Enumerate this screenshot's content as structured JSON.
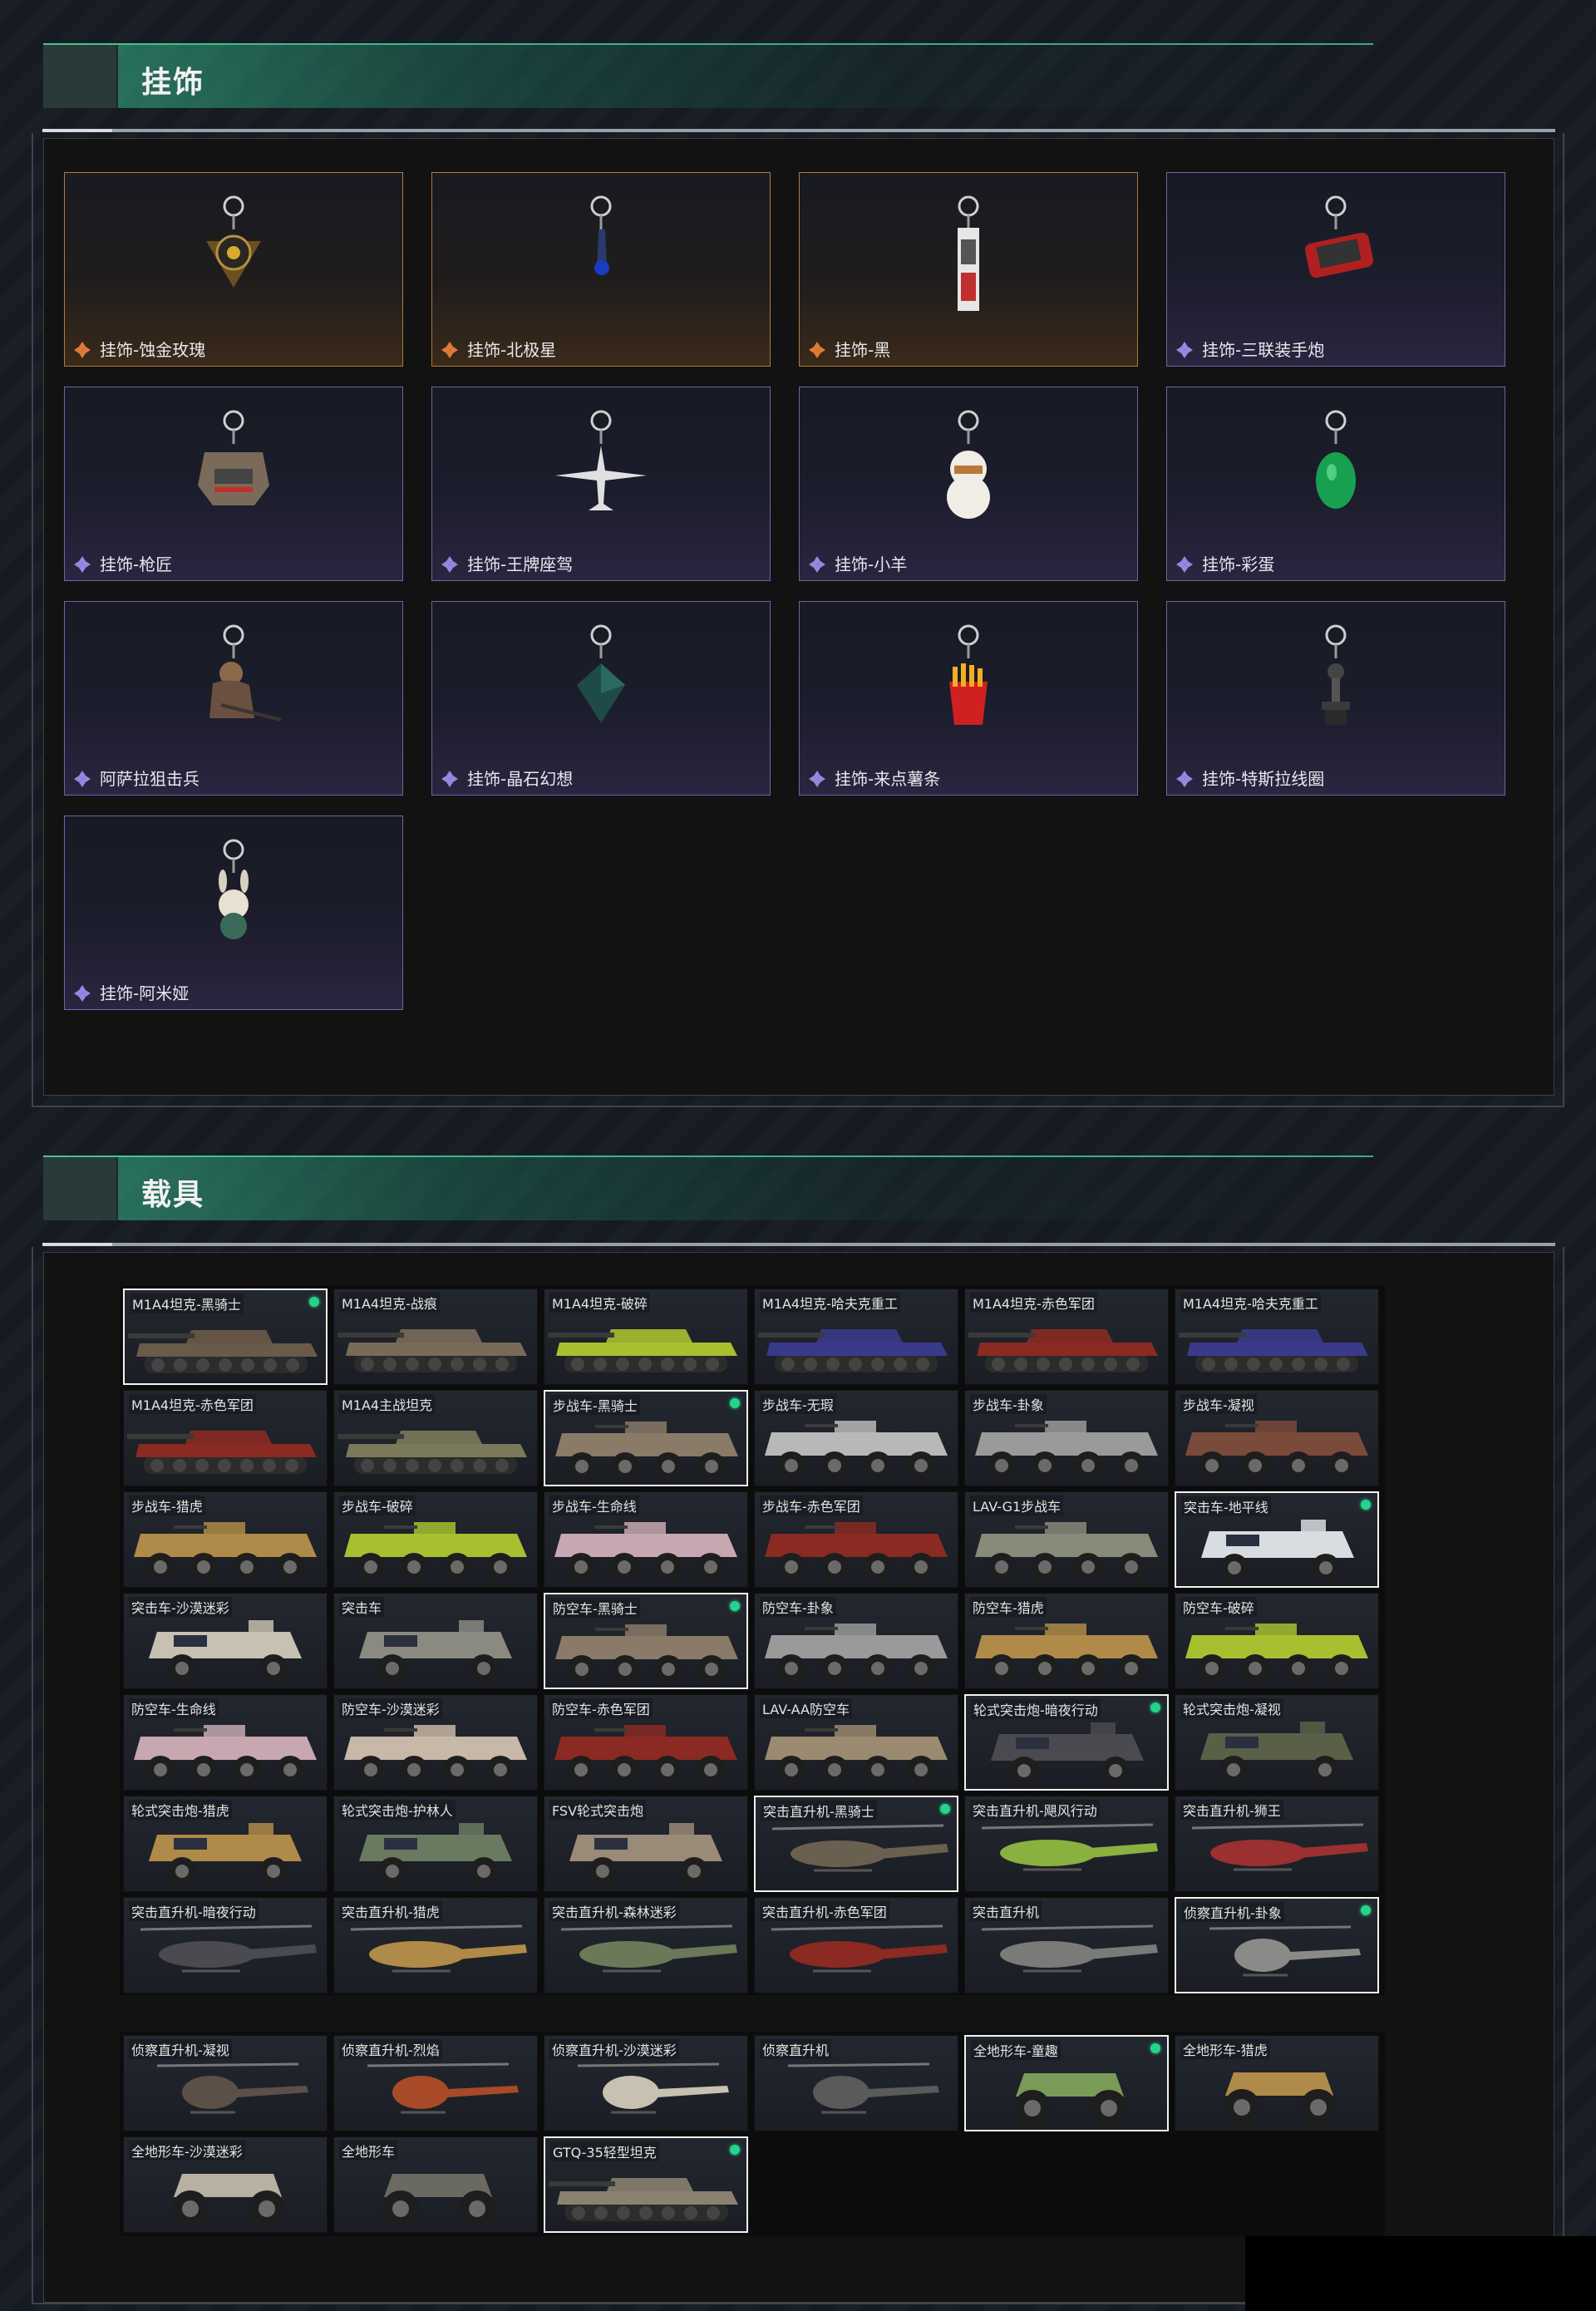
{
  "sections": {
    "charms_title": "挂饰",
    "vehicles_title": "载具"
  },
  "charms": [
    {
      "label": "挂饰-蚀金玫瑰",
      "rarity": "gold",
      "icon": "rose-charm-icon"
    },
    {
      "label": "挂饰-北极星",
      "rarity": "gold",
      "icon": "polaris-charm-icon"
    },
    {
      "label": "挂饰-黑",
      "rarity": "gold",
      "icon": "black-tag-charm-icon"
    },
    {
      "label": "挂饰-三联装手炮",
      "rarity": "purple",
      "icon": "hand-cannon-charm-icon"
    },
    {
      "label": "挂饰-枪匠",
      "rarity": "purple",
      "icon": "gunsmith-charm-icon"
    },
    {
      "label": "挂饰-王牌座驾",
      "rarity": "purple",
      "icon": "jet-charm-icon"
    },
    {
      "label": "挂饰-小羊",
      "rarity": "purple",
      "icon": "lamb-charm-icon"
    },
    {
      "label": "挂饰-彩蛋",
      "rarity": "purple",
      "icon": "egg-charm-icon"
    },
    {
      "label": "阿萨拉狙击兵",
      "rarity": "purple",
      "icon": "sniper-charm-icon"
    },
    {
      "label": "挂饰-晶石幻想",
      "rarity": "purple",
      "icon": "crystal-charm-icon"
    },
    {
      "label": "挂饰-来点薯条",
      "rarity": "purple",
      "icon": "fries-charm-icon"
    },
    {
      "label": "挂饰-特斯拉线圈",
      "rarity": "purple",
      "icon": "tesla-coil-charm-icon"
    },
    {
      "label": "挂饰-阿米娅",
      "rarity": "purple",
      "icon": "amiya-charm-icon"
    }
  ],
  "vehicles_main": [
    {
      "label": "M1A4坦克-黑骑士",
      "kind": "tank",
      "camo": "#6a5a48",
      "selected": true,
      "owned": true
    },
    {
      "label": "M1A4坦克-战痕",
      "kind": "tank",
      "camo": "#7a6a5a"
    },
    {
      "label": "M1A4坦克-破碎",
      "kind": "tank",
      "camo": "#a8c030"
    },
    {
      "label": "M1A4坦克-哈夫克重工",
      "kind": "tank",
      "camo": "#3a3a8a"
    },
    {
      "label": "M1A4坦克-赤色军团",
      "kind": "tank",
      "camo": "#8a2a22"
    },
    {
      "label": "M1A4坦克-哈夫克重工",
      "kind": "tank",
      "camo": "#3a3a8a"
    },
    {
      "label": "M1A4坦克-赤色军团",
      "kind": "tank",
      "camo": "#8a2a22"
    },
    {
      "label": "M1A4主战坦克",
      "kind": "tank",
      "camo": "#7a7a5a"
    },
    {
      "label": "步战车-黑骑士",
      "kind": "ifv",
      "camo": "#8a7a68",
      "selected": true,
      "owned": true
    },
    {
      "label": "步战车-无瑕",
      "kind": "ifv",
      "camo": "#b8b8b8"
    },
    {
      "label": "步战车-卦象",
      "kind": "ifv",
      "camo": "#9a9a9a"
    },
    {
      "label": "步战车-凝视",
      "kind": "ifv",
      "camo": "#7a4a3a"
    },
    {
      "label": "步战车-猎虎",
      "kind": "ifv",
      "camo": "#b08a48"
    },
    {
      "label": "步战车-破碎",
      "kind": "ifv",
      "camo": "#a8c030"
    },
    {
      "label": "步战车-生命线",
      "kind": "ifv",
      "camo": "#c8a8b0"
    },
    {
      "label": "步战车-赤色军团",
      "kind": "ifv",
      "camo": "#8a2a22"
    },
    {
      "label": "LAV-G1步战车",
      "kind": "ifv",
      "camo": "#8a8a7a"
    },
    {
      "label": "突击车-地平线",
      "kind": "truck",
      "camo": "#d8dde2",
      "selected": true,
      "owned": true
    },
    {
      "label": "突击车-沙漠迷彩",
      "kind": "truck",
      "camo": "#c8c0b0"
    },
    {
      "label": "突击车",
      "kind": "truck",
      "camo": "#8a8a80"
    },
    {
      "label": "防空车-黑骑士",
      "kind": "ifv",
      "camo": "#8a7a68",
      "selected": true,
      "owned": true
    },
    {
      "label": "防空车-卦象",
      "kind": "ifv",
      "camo": "#9a9a9a"
    },
    {
      "label": "防空车-猎虎",
      "kind": "ifv",
      "camo": "#b08a48"
    },
    {
      "label": "防空车-破碎",
      "kind": "ifv",
      "camo": "#a8c030"
    },
    {
      "label": "防空车-生命线",
      "kind": "ifv",
      "camo": "#c8a8b0"
    },
    {
      "label": "防空车-沙漠迷彩",
      "kind": "ifv",
      "camo": "#c8b8a8"
    },
    {
      "label": "防空车-赤色军团",
      "kind": "ifv",
      "camo": "#8a2a22"
    },
    {
      "label": "LAV-AA防空车",
      "kind": "ifv",
      "camo": "#9a8a70"
    },
    {
      "label": "轮式突击炮-暗夜行动",
      "kind": "truck",
      "camo": "#4a4a50",
      "selected": true,
      "owned": true
    },
    {
      "label": "轮式突击炮-凝视",
      "kind": "truck",
      "camo": "#5a6048"
    },
    {
      "label": "轮式突击炮-猎虎",
      "kind": "truck",
      "camo": "#b08a48"
    },
    {
      "label": "轮式突击炮-护林人",
      "kind": "truck",
      "camo": "#6a7a60"
    },
    {
      "label": "FSV轮式突击炮",
      "kind": "truck",
      "camo": "#9a8a78"
    },
    {
      "label": "突击直升机-黑骑士",
      "kind": "heli",
      "camo": "#6a6050",
      "selected": true,
      "owned": true
    },
    {
      "label": "突击直升机-飓风行动",
      "kind": "heli",
      "camo": "#8ab040"
    },
    {
      "label": "突击直升机-狮王",
      "kind": "heli",
      "camo": "#9a3030"
    },
    {
      "label": "突击直升机-暗夜行动",
      "kind": "heli",
      "camo": "#4a4a50"
    },
    {
      "label": "突击直升机-猎虎",
      "kind": "heli",
      "camo": "#b08a48"
    },
    {
      "label": "突击直升机-森林迷彩",
      "kind": "heli",
      "camo": "#6a7a58"
    },
    {
      "label": "突击直升机-赤色军团",
      "kind": "heli",
      "camo": "#8a2a22"
    },
    {
      "label": "突击直升机",
      "kind": "heli",
      "camo": "#7a7a78"
    },
    {
      "label": "侦察直升机-卦象",
      "kind": "scout",
      "camo": "#8a8a88",
      "selected": true,
      "owned": true
    }
  ],
  "vehicles_extra": [
    {
      "label": "侦察直升机-凝视",
      "kind": "scout",
      "camo": "#5a5048"
    },
    {
      "label": "侦察直升机-烈焰",
      "kind": "scout",
      "camo": "#a84a28"
    },
    {
      "label": "侦察直升机-沙漠迷彩",
      "kind": "scout",
      "camo": "#c8c0b0"
    },
    {
      "label": "侦察直升机",
      "kind": "scout",
      "camo": "#5a5a5a"
    },
    {
      "label": "全地形车-童趣",
      "kind": "atv",
      "camo": "#7a9a58",
      "selected": true,
      "owned": true
    },
    {
      "label": "全地形车-猎虎",
      "kind": "atv",
      "camo": "#b08a48"
    },
    {
      "label": "全地形车-沙漠迷彩",
      "kind": "atv",
      "camo": "#b8b0a0"
    },
    {
      "label": "全地形车",
      "kind": "atv",
      "camo": "#6a6a60"
    },
    {
      "label": "GTQ-35轻型坦克",
      "kind": "tank",
      "camo": "#8a8270",
      "selected": true,
      "owned": true
    }
  ]
}
